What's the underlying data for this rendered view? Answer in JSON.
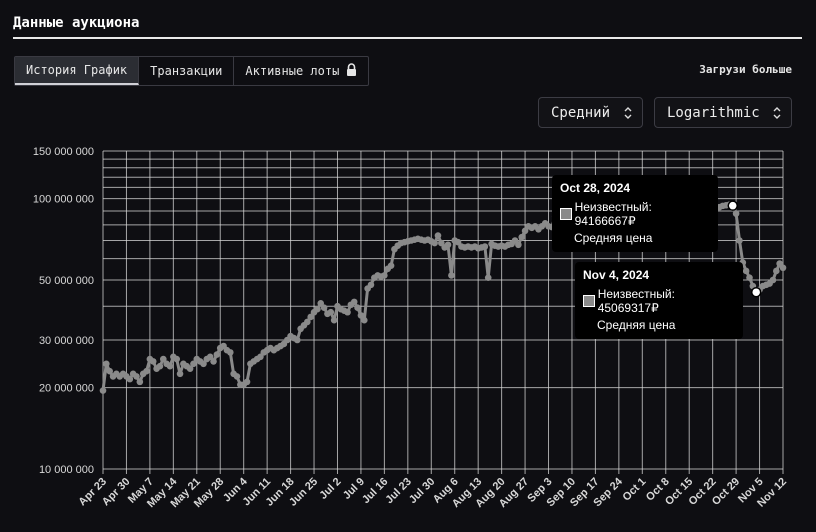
{
  "header": {
    "title": "Данные аукциона"
  },
  "tabs": [
    {
      "label": "История График",
      "active": true
    },
    {
      "label": "Транзакции",
      "active": false
    },
    {
      "label": "Активные лоты",
      "active": false,
      "icon": "lock-icon"
    }
  ],
  "load_more_label": "Загрузи больше",
  "controls": {
    "aggregation": {
      "value": "Средний"
    },
    "scale": {
      "value": "Logarithmic"
    }
  },
  "tooltips": [
    {
      "date": "Oct 28, 2024",
      "series_label": "Неизвестный: 94166667₽",
      "caption": "Средняя цена"
    },
    {
      "date": "Nov 4, 2024",
      "series_label": "Неизвестный: 45069317₽",
      "caption": "Средняя цена"
    }
  ],
  "colors": {
    "line": "#8a8a8a",
    "grid": "#d9d9d9",
    "background": "#0e0e12",
    "tooltip_bg": "#000000"
  },
  "chart_data": {
    "type": "line",
    "title": "",
    "xlabel": "",
    "ylabel": "",
    "y_scale": "log",
    "ylim": [
      10000000,
      150000000
    ],
    "grid": true,
    "y_ticks": [
      10000000,
      20000000,
      30000000,
      50000000,
      100000000,
      150000000
    ],
    "y_tick_labels": [
      "10 000 000",
      "20 000 000",
      "30 000 000",
      "50 000 000",
      "100 000 000",
      "150 000 000"
    ],
    "x_tick_labels": [
      "Apr 23",
      "Apr 30",
      "May 7",
      "May 14",
      "May 21",
      "May 28",
      "Jun 4",
      "Jun 11",
      "Jun 18",
      "Jun 25",
      "Jul 2",
      "Jul 9",
      "Jul 16",
      "Jul 23",
      "Jul 30",
      "Aug 6",
      "Aug 13",
      "Aug 20",
      "Aug 27",
      "Sep 3",
      "Sep 10",
      "Sep 17",
      "Sep 24",
      "Oct 1",
      "Oct 8",
      "Oct 15",
      "Oct 22",
      "Oct 29",
      "Nov 5",
      "Nov 12"
    ],
    "series": [
      {
        "name": "Неизвестный",
        "points": [
          [
            "Apr 23",
            19500000
          ],
          [
            "Apr 24",
            24500000
          ],
          [
            "Apr 25",
            23000000
          ],
          [
            "Apr 26",
            22000000
          ],
          [
            "Apr 27",
            22500000
          ],
          [
            "Apr 28",
            22000000
          ],
          [
            "Apr 29",
            22500000
          ],
          [
            "Apr 30",
            22000000
          ],
          [
            "May 1",
            21500000
          ],
          [
            "May 2",
            22500000
          ],
          [
            "May 3",
            22000000
          ],
          [
            "May 4",
            21000000
          ],
          [
            "May 5",
            22500000
          ],
          [
            "May 6",
            23000000
          ],
          [
            "May 7",
            25500000
          ],
          [
            "May 8",
            25000000
          ],
          [
            "May 9",
            23500000
          ],
          [
            "May 10",
            24000000
          ],
          [
            "May 11",
            25500000
          ],
          [
            "May 12",
            24500000
          ],
          [
            "May 13",
            24000000
          ],
          [
            "May 14",
            26000000
          ],
          [
            "May 15",
            25500000
          ],
          [
            "May 16",
            22500000
          ],
          [
            "May 17",
            24500000
          ],
          [
            "May 18",
            24000000
          ],
          [
            "May 19",
            23500000
          ],
          [
            "May 20",
            24500000
          ],
          [
            "May 21",
            25500000
          ],
          [
            "May 22",
            25000000
          ],
          [
            "May 23",
            24500000
          ],
          [
            "May 24",
            25500000
          ],
          [
            "May 25",
            26000000
          ],
          [
            "May 26",
            25000000
          ],
          [
            "May 27",
            26500000
          ],
          [
            "May 28",
            28000000
          ],
          [
            "May 29",
            28500000
          ],
          [
            "May 30",
            27500000
          ],
          [
            "May 31",
            27000000
          ],
          [
            "Jun 1",
            22500000
          ],
          [
            "Jun 2",
            22000000
          ],
          [
            "Jun 3",
            20500000
          ],
          [
            "Jun 4",
            20500000
          ],
          [
            "Jun 5",
            21000000
          ],
          [
            "Jun 6",
            24500000
          ],
          [
            "Jun 7",
            25000000
          ],
          [
            "Jun 8",
            25500000
          ],
          [
            "Jun 9",
            26000000
          ],
          [
            "Jun 10",
            27000000
          ],
          [
            "Jun 11",
            27500000
          ],
          [
            "Jun 12",
            28000000
          ],
          [
            "Jun 13",
            27500000
          ],
          [
            "Jun 14",
            28000000
          ],
          [
            "Jun 15",
            28500000
          ],
          [
            "Jun 16",
            29000000
          ],
          [
            "Jun 17",
            30000000
          ],
          [
            "Jun 18",
            31000000
          ],
          [
            "Jun 19",
            30500000
          ],
          [
            "Jun 20",
            30000000
          ],
          [
            "Jun 21",
            33000000
          ],
          [
            "Jun 22",
            34000000
          ],
          [
            "Jun 23",
            35000000
          ],
          [
            "Jun 24",
            36500000
          ],
          [
            "Jun 25",
            38000000
          ],
          [
            "Jun 26",
            39000000
          ],
          [
            "Jun 27",
            41000000
          ],
          [
            "Jun 28",
            39500000
          ],
          [
            "Jun 29",
            37500000
          ],
          [
            "Jun 30",
            38000000
          ],
          [
            "Jul 1",
            35500000
          ],
          [
            "Jul 2",
            40000000
          ],
          [
            "Jul 3",
            39000000
          ],
          [
            "Jul 4",
            38500000
          ],
          [
            "Jul 5",
            38000000
          ],
          [
            "Jul 6",
            40500000
          ],
          [
            "Jul 7",
            41500000
          ],
          [
            "Jul 8",
            39500000
          ],
          [
            "Jul 9",
            37000000
          ],
          [
            "Jul 10",
            35500000
          ],
          [
            "Jul 11",
            46500000
          ],
          [
            "Jul 12",
            48000000
          ],
          [
            "Jul 13",
            51000000
          ],
          [
            "Jul 14",
            52000000
          ],
          [
            "Jul 15",
            51500000
          ],
          [
            "Jul 16",
            52000000
          ],
          [
            "Jul 17",
            55000000
          ],
          [
            "Jul 18",
            56500000
          ],
          [
            "Jul 19",
            65000000
          ],
          [
            "Jul 20",
            67000000
          ],
          [
            "Jul 21",
            68500000
          ],
          [
            "Jul 22",
            69000000
          ],
          [
            "Jul 23",
            69500000
          ],
          [
            "Jul 24",
            70000000
          ],
          [
            "Jul 25",
            70500000
          ],
          [
            "Jul 26",
            71000000
          ],
          [
            "Jul 27",
            70500000
          ],
          [
            "Jul 28",
            70000000
          ],
          [
            "Jul 29",
            70500000
          ],
          [
            "Jul 30",
            69500000
          ],
          [
            "Jul 31",
            68500000
          ],
          [
            "Aug 1",
            73000000
          ],
          [
            "Aug 2",
            68500000
          ],
          [
            "Aug 3",
            66000000
          ],
          [
            "Aug 4",
            67500000
          ],
          [
            "Aug 5",
            52000000
          ],
          [
            "Aug 6",
            70000000
          ],
          [
            "Aug 7",
            69000000
          ],
          [
            "Aug 8",
            66500000
          ],
          [
            "Aug 9",
            66000000
          ],
          [
            "Aug 10",
            66500000
          ],
          [
            "Aug 11",
            66000000
          ],
          [
            "Aug 12",
            66500000
          ],
          [
            "Aug 13",
            65500000
          ],
          [
            "Aug 14",
            66000000
          ],
          [
            "Aug 15",
            66500000
          ],
          [
            "Aug 16",
            51000000
          ],
          [
            "Aug 17",
            68000000
          ],
          [
            "Aug 18",
            67000000
          ],
          [
            "Aug 19",
            66500000
          ],
          [
            "Aug 20",
            67000000
          ],
          [
            "Aug 21",
            66500000
          ],
          [
            "Aug 22",
            67500000
          ],
          [
            "Aug 23",
            68000000
          ],
          [
            "Aug 24",
            70000000
          ],
          [
            "Aug 25",
            67500000
          ],
          [
            "Aug 26",
            72000000
          ],
          [
            "Aug 27",
            76000000
          ],
          [
            "Aug 28",
            79000000
          ],
          [
            "Aug 29",
            78000000
          ],
          [
            "Aug 30",
            79000000
          ],
          [
            "Aug 31",
            77000000
          ],
          [
            "Sep 1",
            79000000
          ],
          [
            "Sep 2",
            81000000
          ],
          [
            "Sep 3",
            79000000
          ],
          [
            "Sep 4",
            78500000
          ],
          [
            "Sep 5",
            86000000
          ],
          [
            "Sep 6",
            88000000
          ],
          [
            "Sep 7",
            90000000
          ],
          [
            "Sep 8",
            91000000
          ],
          [
            "Sep 9",
            92500000
          ],
          [
            "Sep 10",
            93000000
          ],
          [
            "Sep 11",
            94500000
          ],
          [
            "Sep 12",
            95000000
          ],
          [
            "Sep 13",
            96000000
          ],
          [
            "Sep 14",
            97000000
          ],
          [
            "Sep 15",
            98500000
          ],
          [
            "Sep 16",
            99500000
          ],
          [
            "Sep 17",
            101000000
          ],
          [
            "Sep 18",
            102500000
          ],
          [
            "Sep 19",
            104000000
          ],
          [
            "Sep 20",
            106000000
          ],
          [
            "Sep 21",
            107500000
          ],
          [
            "Sep 22",
            109000000
          ],
          [
            "Sep 23",
            112000000
          ],
          [
            "Sep 24",
            118000000
          ],
          [
            "Sep 25",
            116000000
          ],
          [
            "Sep 26",
            110000000
          ],
          [
            "Sep 27",
            108000000
          ],
          [
            "Sep 28",
            105000000
          ],
          [
            "Sep 29",
            103000000
          ],
          [
            "Sep 30",
            101000000
          ],
          [
            "Oct 1",
            100500000
          ],
          [
            "Oct 2",
            100000000
          ],
          [
            "Oct 3",
            99500000
          ],
          [
            "Oct 4",
            99000000
          ],
          [
            "Oct 5",
            98500000
          ],
          [
            "Oct 6",
            98000000
          ],
          [
            "Oct 7",
            97500000
          ],
          [
            "Oct 8",
            97000000
          ],
          [
            "Oct 9",
            96500000
          ],
          [
            "Oct 10",
            96000000
          ],
          [
            "Oct 11",
            95500000
          ],
          [
            "Oct 12",
            95000000
          ],
          [
            "Oct 13",
            94500000
          ],
          [
            "Oct 14",
            94000000
          ],
          [
            "Oct 15",
            93500000
          ],
          [
            "Oct 16",
            93000000
          ],
          [
            "Oct 17",
            92500000
          ],
          [
            "Oct 18",
            92000000
          ],
          [
            "Oct 19",
            91500000
          ],
          [
            "Oct 20",
            91000000
          ],
          [
            "Oct 21",
            91500000
          ],
          [
            "Oct 22",
            92000000
          ],
          [
            "Oct 23",
            92500000
          ],
          [
            "Oct 24",
            93000000
          ],
          [
            "Oct 25",
            94000000
          ],
          [
            "Oct 26",
            94500000
          ],
          [
            "Oct 27",
            95000000
          ],
          [
            "Oct 28",
            94166667
          ],
          [
            "Oct 29",
            88000000
          ],
          [
            "Oct 30",
            70000000
          ],
          [
            "Oct 31",
            58000000
          ],
          [
            "Nov 1",
            54000000
          ],
          [
            "Nov 2",
            51000000
          ],
          [
            "Nov 3",
            47500000
          ],
          [
            "Nov 4",
            45069317
          ],
          [
            "Nov 5",
            46000000
          ],
          [
            "Nov 6",
            47500000
          ],
          [
            "Nov 7",
            48000000
          ],
          [
            "Nov 8",
            48500000
          ],
          [
            "Nov 9",
            50000000
          ],
          [
            "Nov 10",
            54000000
          ],
          [
            "Nov 11",
            57500000
          ],
          [
            "Nov 12",
            55500000
          ]
        ]
      }
    ]
  }
}
